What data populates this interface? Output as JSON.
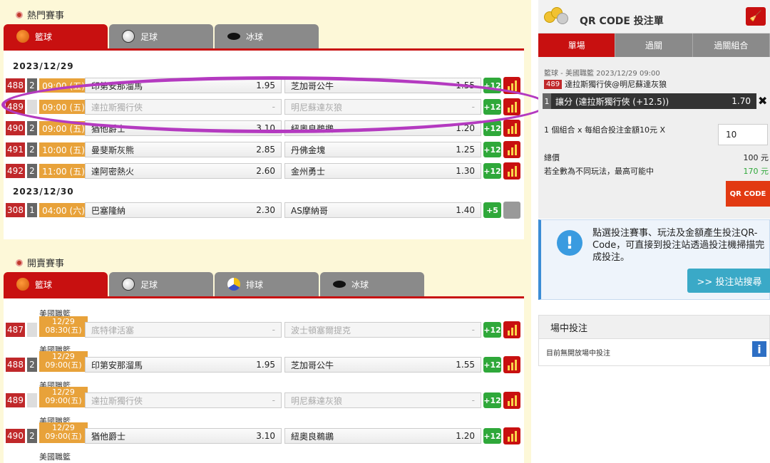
{
  "hot": {
    "title": "熱門賽事",
    "tabs": [
      {
        "label": "籃球",
        "icon": "basketball-icon"
      },
      {
        "label": "足球",
        "icon": "soccer-icon"
      },
      {
        "label": "冰球",
        "icon": "hockey-puck-icon"
      }
    ],
    "dates": [
      "2023/12/29",
      "2023/12/30"
    ],
    "rows": [
      {
        "num": "488",
        "cnt": "2",
        "time": "09:00 (五)",
        "home": "印第安那溜馬",
        "home_odds": "1.95",
        "away": "芝加哥公牛",
        "away_odds": "1.55",
        "more": "+12"
      },
      {
        "num": "489",
        "cnt": "",
        "time": "09:00 (五)",
        "home": "達拉斯獨行俠",
        "home_odds": "-",
        "away": "明尼蘇達灰狼",
        "away_odds": "-",
        "more": "+12"
      },
      {
        "num": "490",
        "cnt": "2",
        "time": "09:00 (五)",
        "home": "猶他爵士",
        "home_odds": "3.10",
        "away": "紐奧良鵜鶘",
        "away_odds": "1.20",
        "more": "+12"
      },
      {
        "num": "491",
        "cnt": "2",
        "time": "10:00 (五)",
        "home": "曼斐斯灰熊",
        "home_odds": "2.85",
        "away": "丹佛金塊",
        "away_odds": "1.25",
        "more": "+12"
      },
      {
        "num": "492",
        "cnt": "2",
        "time": "11:00 (五)",
        "home": "達阿密熱火",
        "home_odds": "2.60",
        "away": "金州勇士",
        "away_odds": "1.30",
        "more": "+12"
      },
      {
        "num": "308",
        "cnt": "1",
        "time": "04:00 (六)",
        "home": "巴塞隆納",
        "home_odds": "2.30",
        "away": "AS摩納哥",
        "away_odds": "1.40",
        "more": "+5"
      }
    ]
  },
  "open": {
    "title": "開賣賽事",
    "tabs": [
      {
        "label": "籃球",
        "icon": "basketball-icon"
      },
      {
        "label": "足球",
        "icon": "soccer-icon"
      },
      {
        "label": "排球",
        "icon": "volleyball-icon"
      },
      {
        "label": "冰球",
        "icon": "hockey-puck-icon"
      }
    ],
    "rows": [
      {
        "league": "美國職籃",
        "num": "487",
        "cnt": "",
        "date": "12/29",
        "time": "08:30(五)",
        "home": "底特律活塞",
        "home_odds": "-",
        "away": "波士頓塞爾提克",
        "away_odds": "-",
        "more": "+12"
      },
      {
        "league": "美國職籃",
        "num": "488",
        "cnt": "2",
        "date": "12/29",
        "time": "09:00(五)",
        "home": "印第安那溜馬",
        "home_odds": "1.95",
        "away": "芝加哥公牛",
        "away_odds": "1.55",
        "more": "+12"
      },
      {
        "league": "美國職籃",
        "num": "489",
        "cnt": "",
        "date": "12/29",
        "time": "09:00(五)",
        "home": "達拉斯獨行俠",
        "home_odds": "-",
        "away": "明尼蘇達灰狼",
        "away_odds": "-",
        "more": "+12"
      },
      {
        "league": "美國職籃",
        "num": "490",
        "cnt": "2",
        "date": "12/29",
        "time": "09:00(五)",
        "home": "猶他爵士",
        "home_odds": "3.10",
        "away": "紐奧良鵜鶘",
        "away_odds": "1.20",
        "more": "+12"
      },
      {
        "league": "美國職籃"
      }
    ]
  },
  "slip": {
    "title": "QR CODE 投注單",
    "tabs": [
      "單場",
      "過關",
      "過關組合"
    ],
    "info": "籃球 - 美國職籃 2023/12/29 09:00",
    "match_num": "489",
    "match": "達拉斯獨行俠@明尼蘇達灰狼",
    "sel_num": "1",
    "selection": "讓分 (達拉斯獨行俠 (+12.5))",
    "odds": "1.70",
    "remove": "✖",
    "combo": "1 個組合 x 每組合投注金額10元 X",
    "amount": "10",
    "total_label": "總價",
    "total_value": "100 元",
    "max_label": "若全數為不同玩法，最高可能中",
    "max_value": "170 元",
    "qr_button": "QR CODE"
  },
  "notice": {
    "text": "點選投注賽事、玩法及金額產生投注QR-Code，可直接到投注站透過投注機掃描完成投注。",
    "search_button": ">> 投注站搜尋"
  },
  "live": {
    "title": "場中投注",
    "text": "目前無開放場中投注",
    "info_icon": "i"
  },
  "colors": {
    "accent": "#c81010",
    "odds_up": "#2fa83a",
    "highlight": "#b43ac0"
  }
}
